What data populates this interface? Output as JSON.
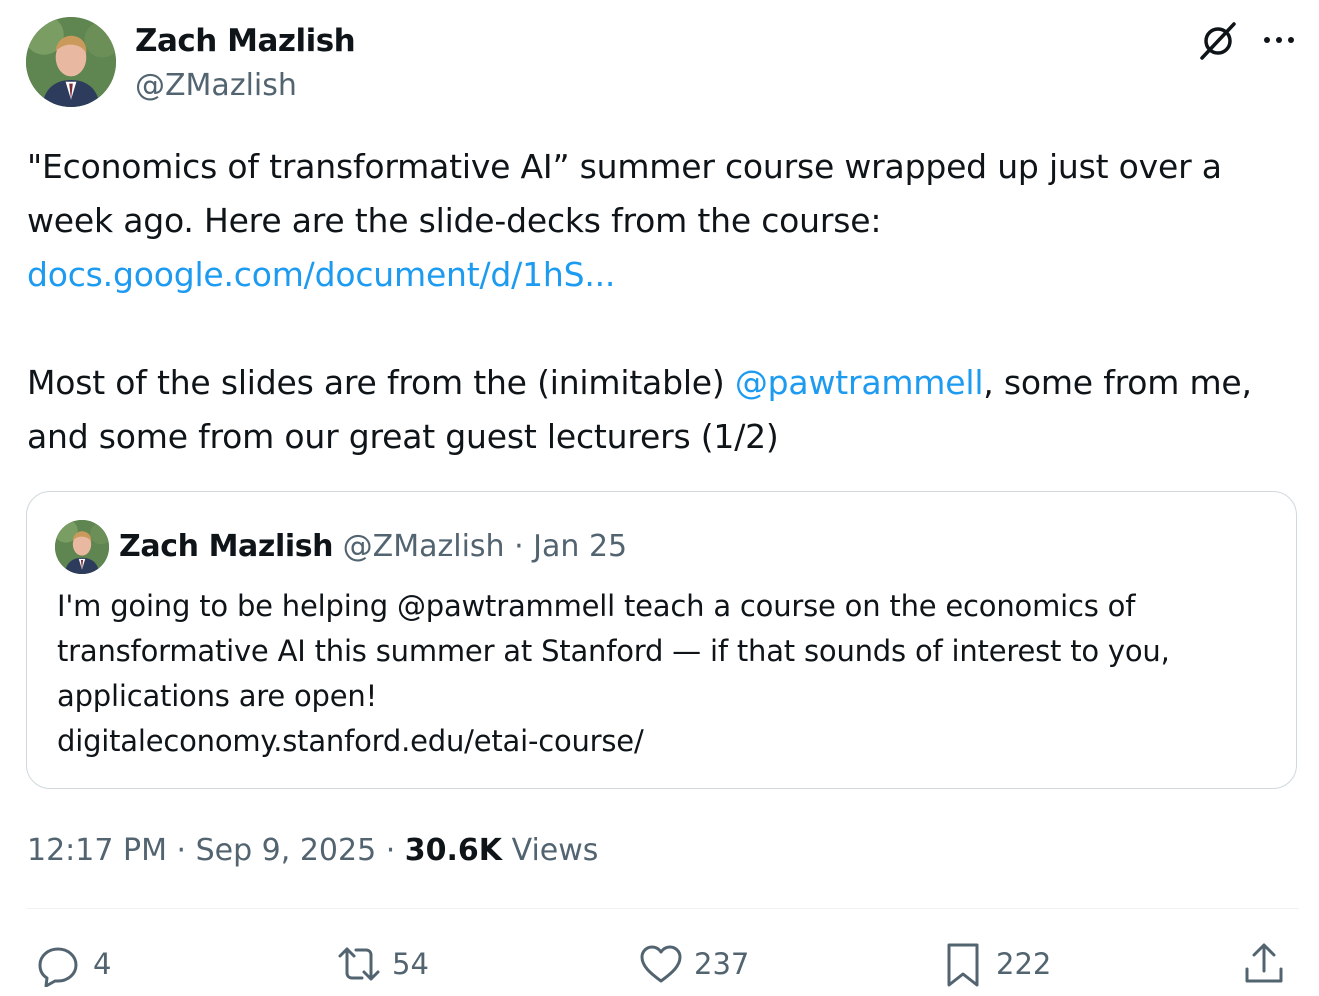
{
  "author": {
    "name": "Zach Mazlish",
    "handle": "@ZMazlish"
  },
  "icons": {
    "grok": "grok-icon",
    "more": "more-icon",
    "reply": "reply-icon",
    "retweet": "retweet-icon",
    "like": "heart-icon",
    "bookmark": "bookmark-icon",
    "share": "share-icon"
  },
  "tweet": {
    "line1": "\"Economics of transformative AI” summer course wrapped up just over a",
    "line2": "week ago. Here are the slide-decks from the course:",
    "link": "docs.google.com/document/d/1hS...",
    "line4_before": "Most of the slides are from the (inimitable) ",
    "mention": "@pawtrammell",
    "line4_after": ", some from me,",
    "line5": "and some from our great guest lecturers (1/2)"
  },
  "quote": {
    "name": "Zach Mazlish",
    "handle": "@ZMazlish",
    "separator": " · ",
    "date": "Jan 25",
    "line1": "I'm going to be helping @pawtrammell teach a course on the economics of",
    "line2": "transformative AI this summer at Stanford — if that sounds of interest to you,",
    "line3": "applications are open!",
    "line4": "digitaleconomy.stanford.edu/etai-course/"
  },
  "meta": {
    "time": "12:17 PM",
    "sep1": " · ",
    "date": "Sep 9, 2025",
    "sep2": " · ",
    "views_count": "30.6K",
    "views_label": " Views"
  },
  "actions": {
    "replies": "4",
    "retweets": "54",
    "likes": "237",
    "bookmarks": "222"
  },
  "colors": {
    "link": "#1d9bf0",
    "secondary_text": "#536471",
    "primary_text": "#0f1419",
    "border": "#cfd9de"
  }
}
